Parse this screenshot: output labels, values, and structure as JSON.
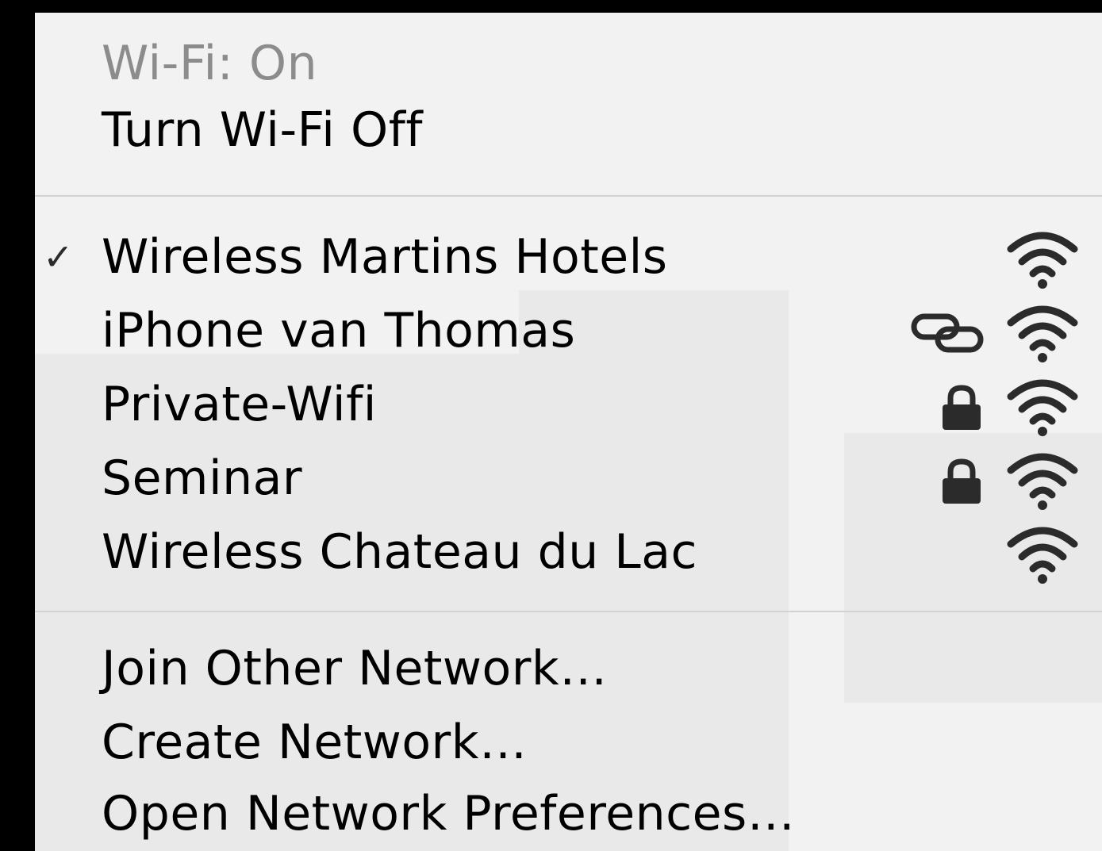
{
  "wifi_menu": {
    "status_label": "Wi-Fi: On",
    "toggle_label": "Turn Wi-Fi Off",
    "networks": [
      {
        "name": "Wireless Martins Hotels",
        "connected": true,
        "secured": false,
        "personal_hotspot": false,
        "signal_icon": "wifi-signal-icon"
      },
      {
        "name": "iPhone van Thomas",
        "connected": false,
        "secured": false,
        "personal_hotspot": true,
        "signal_icon": "wifi-signal-icon"
      },
      {
        "name": "Private-Wifi",
        "connected": false,
        "secured": true,
        "personal_hotspot": false,
        "signal_icon": "wifi-signal-icon"
      },
      {
        "name": "Seminar",
        "connected": false,
        "secured": true,
        "personal_hotspot": false,
        "signal_icon": "wifi-signal-icon"
      },
      {
        "name": "Wireless Chateau du Lac",
        "connected": false,
        "secured": false,
        "personal_hotspot": false,
        "signal_icon": "wifi-signal-icon"
      }
    ],
    "join_other_label": "Join Other Network…",
    "create_network_label": "Create Network…",
    "open_prefs_label": "Open Network Preferences…",
    "checkmark_glyph": "✓"
  },
  "colors": {
    "menu_background": "#f2f2f2",
    "text": "#000000",
    "disabled_text": "#8c8c8c",
    "separator": "#d2d2d2",
    "icon": "#2b2b2b",
    "outside_background": "#000000"
  }
}
